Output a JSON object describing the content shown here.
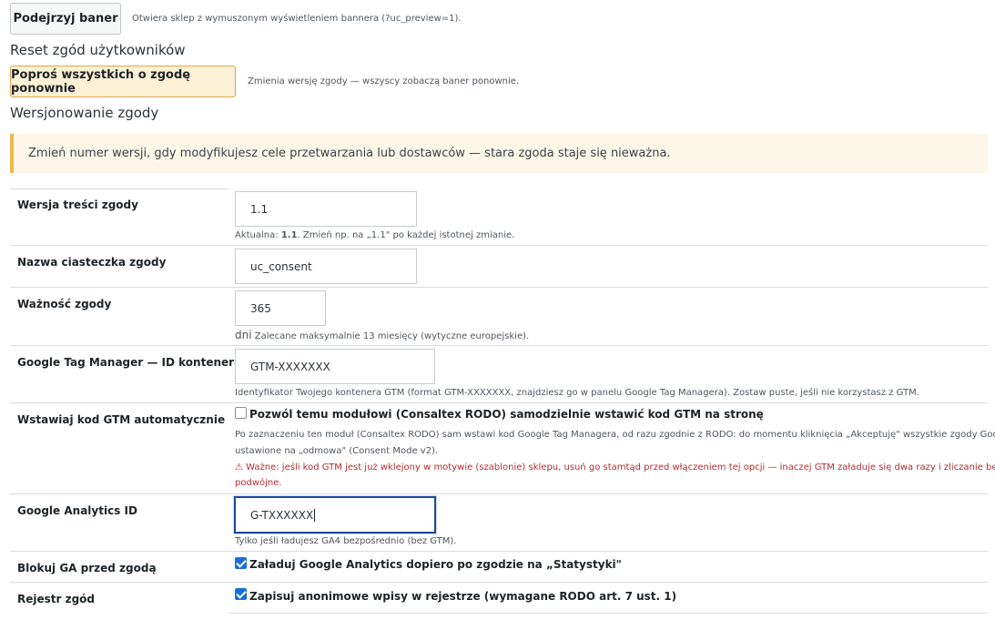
{
  "preview": {
    "button_label": "Podejrzyj baner",
    "hint": "Otwiera sklep z wymuszonym wyświetleniem bannera (?uc_preview=1)."
  },
  "reset": {
    "title": "Reset zgód użytkowników",
    "button_label": "Poproś wszystkich o zgodę ponownie",
    "hint": "Zmienia wersję zgody — wszyscy zobaczą baner ponownie."
  },
  "versioning": {
    "title": "Wersjonowanie zgody",
    "notice": "Zmień numer wersji, gdy modyfikujesz cele przetwarzania lub dostawców — stara zgoda staje się nieważna."
  },
  "fields": {
    "version": {
      "label": "Wersja treści zgody",
      "value": "1.1",
      "hint_prefix": "Aktualna: ",
      "hint_bold": "1.1",
      "hint_suffix": ". Zmień np. na „1.1\" po każdej istotnej zmianie."
    },
    "cookie": {
      "label": "Nazwa ciasteczka zgody",
      "value": "uc_consent"
    },
    "validity": {
      "label": "Ważność zgody",
      "value": "365",
      "unit": "dni",
      "hint": "Zalecane maksymalnie 13 miesięcy (wytyczne europejskie)."
    },
    "gtm": {
      "label": "Google Tag Manager — ID kontenera",
      "value": "GTM-XXXXXXX",
      "hint": "Identyfikator Twojego kontenera GTM (format GTM-XXXXXXX, znajdziesz go w panelu Google Tag Managera). Zostaw puste, jeśli nie korzystasz z GTM."
    },
    "gtm_auto": {
      "label": "Wstawiaj kod GTM automatycznie",
      "checkbox_label": "Pozwól temu modułowi (Consaltex RODO) samodzielnie wstawić kod GTM na stronę",
      "checked": false,
      "desc_line1": "Po zaznaczeniu ten moduł (Consaltex RODO) sam wstawi kod Google Tag Managera, od razu zgodnie z RODO: do momentu kliknięcia „Akceptuję\" wszystkie zgody Google są",
      "desc_line2": "ustawione na „odmowa\" (Consent Mode v2).",
      "warn_line1": "⚠ Ważne: jeśli kod GTM jest już wklejony w motywie (szablonie) sklepu, usuń go stamtąd przed włączeniem tej opcji — inaczej GTM załaduje się dwa razy i zliczanie będzie",
      "warn_line2": "podwójne."
    },
    "ga": {
      "label": "Google Analytics ID",
      "value": "G-TXXXXXX",
      "hint": "Tylko jeśli ładujesz GA4 bezpośrednio (bez GTM)."
    },
    "block_ga": {
      "label": "Blokuj GA przed zgodą",
      "checkbox_label": "Załaduj Google Analytics dopiero po zgodzie na „Statystyki\"",
      "checked": true
    },
    "registry": {
      "label": "Rejestr zgód",
      "checkbox_label": "Zapisuj anonimowe wpisy w rejestrze (wymagane RODO art. 7 ust. 1)",
      "checked": true
    }
  },
  "colors": {
    "focus_border": "#1c4a9e",
    "notice_bg": "#fcf6e6",
    "notice_border": "#f0b849",
    "warning_text": "#b32d2e",
    "checkbox_checked": "#1a6fd6"
  }
}
